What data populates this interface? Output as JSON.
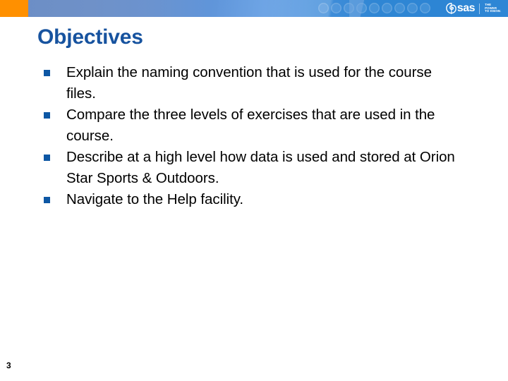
{
  "slide": {
    "title": "Objectives",
    "page_number": "3",
    "bullets": [
      {
        "text": "Explain the naming convention that is used for the course files.",
        "marker": "square-bullet"
      },
      {
        "text": "Compare the three levels of exercises that are used in the course.",
        "marker": "square-bullet"
      },
      {
        "text": "Describe at a high level how data is used and stored at Orion Star Sports & Outdoors.",
        "marker": "square-bullet"
      },
      {
        "text": "Navigate to the Help facility.",
        "marker": "square-bullet"
      }
    ]
  },
  "header": {
    "logo_word": "sas",
    "tagline_line1": "THE",
    "tagline_line2": "POWER",
    "tagline_line3": "TO KNOW.",
    "logo_mark": "sas-swirl-icon",
    "decor_dots": [
      "dot",
      "dot",
      "dot",
      "dot",
      "dot",
      "dot",
      "dot",
      "dot",
      "dot"
    ]
  },
  "colors": {
    "accent_orange": "#ff9000",
    "header_blue_left": "#6b8dc4",
    "header_blue_right": "#2e86d5",
    "title_blue": "#17539f",
    "bullet_blue": "#0d57a4",
    "body_text": "#000000",
    "background": "#ffffff"
  }
}
